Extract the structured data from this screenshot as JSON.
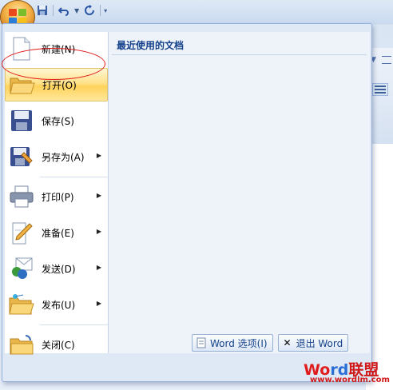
{
  "quick_access": {
    "save_icon": "save-icon",
    "undo_icon": "undo-icon",
    "redo_icon": "redo-icon",
    "customize_icon": "customize-icon"
  },
  "office_button": {
    "icon": "office-logo-icon"
  },
  "menu": {
    "items": [
      {
        "label": "新建(N)",
        "icon": "new-document-icon",
        "submenu": false
      },
      {
        "label": "打开(O)",
        "icon": "open-folder-icon",
        "submenu": false,
        "highlighted": true
      },
      {
        "label": "保存(S)",
        "icon": "save-disk-icon",
        "submenu": false
      },
      {
        "label": "另存为(A)",
        "icon": "save-as-icon",
        "submenu": true
      },
      {
        "label": "打印(P)",
        "icon": "printer-icon",
        "submenu": true
      },
      {
        "label": "准备(E)",
        "icon": "prepare-icon",
        "submenu": true
      },
      {
        "label": "发送(D)",
        "icon": "send-icon",
        "submenu": true
      },
      {
        "label": "发布(U)",
        "icon": "publish-icon",
        "submenu": true
      },
      {
        "label": "关闭(C)",
        "icon": "close-document-icon",
        "submenu": false
      }
    ],
    "submenu_arrow": "▶"
  },
  "recent": {
    "title": "最近使用的文档"
  },
  "footer": {
    "options_label": "Word 选项(I)",
    "exit_label": "退出 Word"
  },
  "watermark": {
    "brand_part1": "Wo",
    "brand_part2": "rd",
    "brand_part3": "联盟",
    "url": "www.wordlm.com"
  },
  "colors": {
    "highlight": "#ffe28a",
    "annotation_circle": "#e11b1b",
    "menu_text": "#000000",
    "header_text": "#15428b"
  }
}
